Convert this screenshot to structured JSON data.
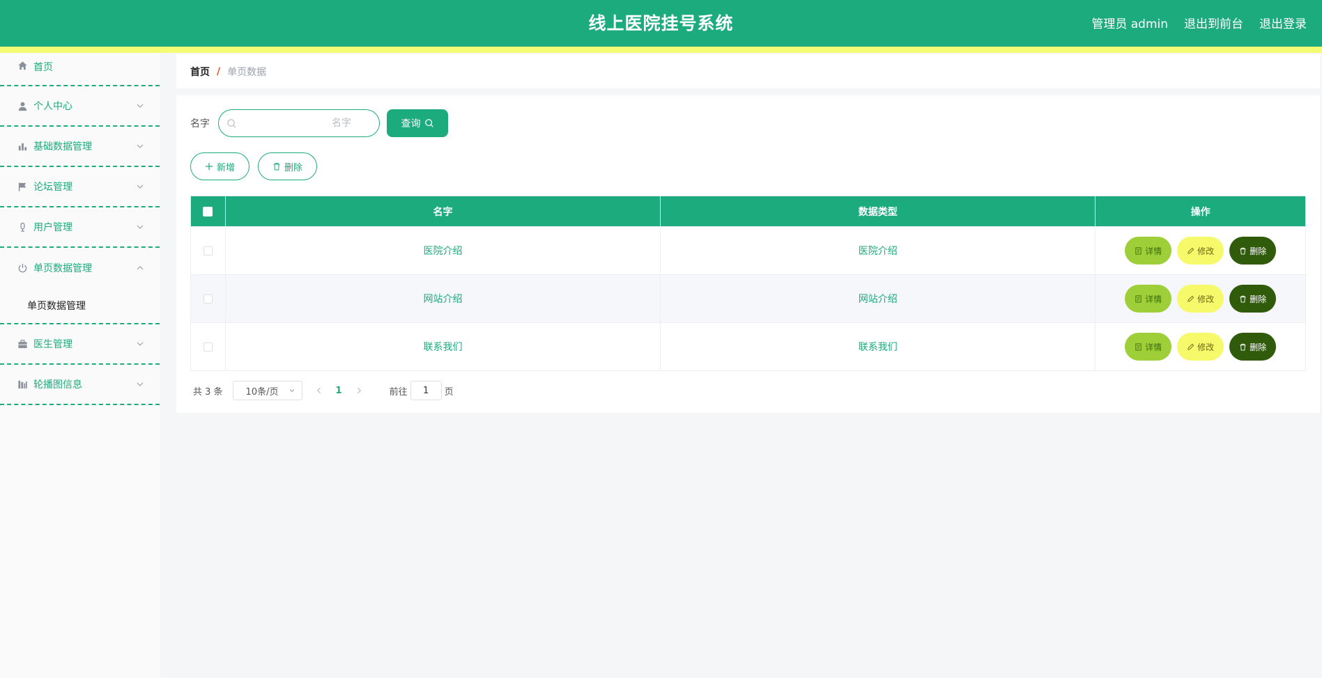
{
  "header": {
    "title": "线上医院挂号系统",
    "admin_label": "管理员 admin",
    "front_link": "退出到前台",
    "logout_link": "退出登录"
  },
  "colors": {
    "primary": "#1bab7c",
    "strip": "#f5fb72",
    "detail": "#9fcf38",
    "edit": "#f6f96a",
    "delete": "#2f5b0a"
  },
  "sidebar": {
    "items": [
      {
        "label": "首页",
        "icon": "home-icon"
      },
      {
        "label": "个人中心",
        "icon": "user-icon"
      },
      {
        "label": "基础数据管理",
        "icon": "bar-chart-icon"
      },
      {
        "label": "论坛管理",
        "icon": "flag-icon"
      },
      {
        "label": "用户管理",
        "icon": "microphone-icon"
      },
      {
        "label": "单页数据管理",
        "icon": "power-icon",
        "expanded": true,
        "children": [
          {
            "label": "单页数据管理"
          }
        ]
      },
      {
        "label": "医生管理",
        "icon": "briefcase-icon"
      },
      {
        "label": "轮播图信息",
        "icon": "chart-icon"
      }
    ]
  },
  "breadcrumb": {
    "home": "首页",
    "separator": "/",
    "current": "单页数据"
  },
  "search": {
    "label": "名字",
    "placeholder": "名字",
    "value": "",
    "button": "查询"
  },
  "actions": {
    "add": "新增",
    "delete": "删除"
  },
  "table": {
    "columns": [
      "名字",
      "数据类型",
      "操作"
    ],
    "rows": [
      {
        "name": "医院介绍",
        "type": "医院介绍"
      },
      {
        "name": "网站介绍",
        "type": "网站介绍"
      },
      {
        "name": "联系我们",
        "type": "联系我们"
      }
    ],
    "ops": {
      "detail": "详情",
      "edit": "修改",
      "delete": "删除"
    }
  },
  "pagination": {
    "total": "共 3 条",
    "page_size": "10条/页",
    "current_page": "1",
    "goto_prefix": "前往",
    "goto_value": "1",
    "goto_suffix": "页"
  }
}
